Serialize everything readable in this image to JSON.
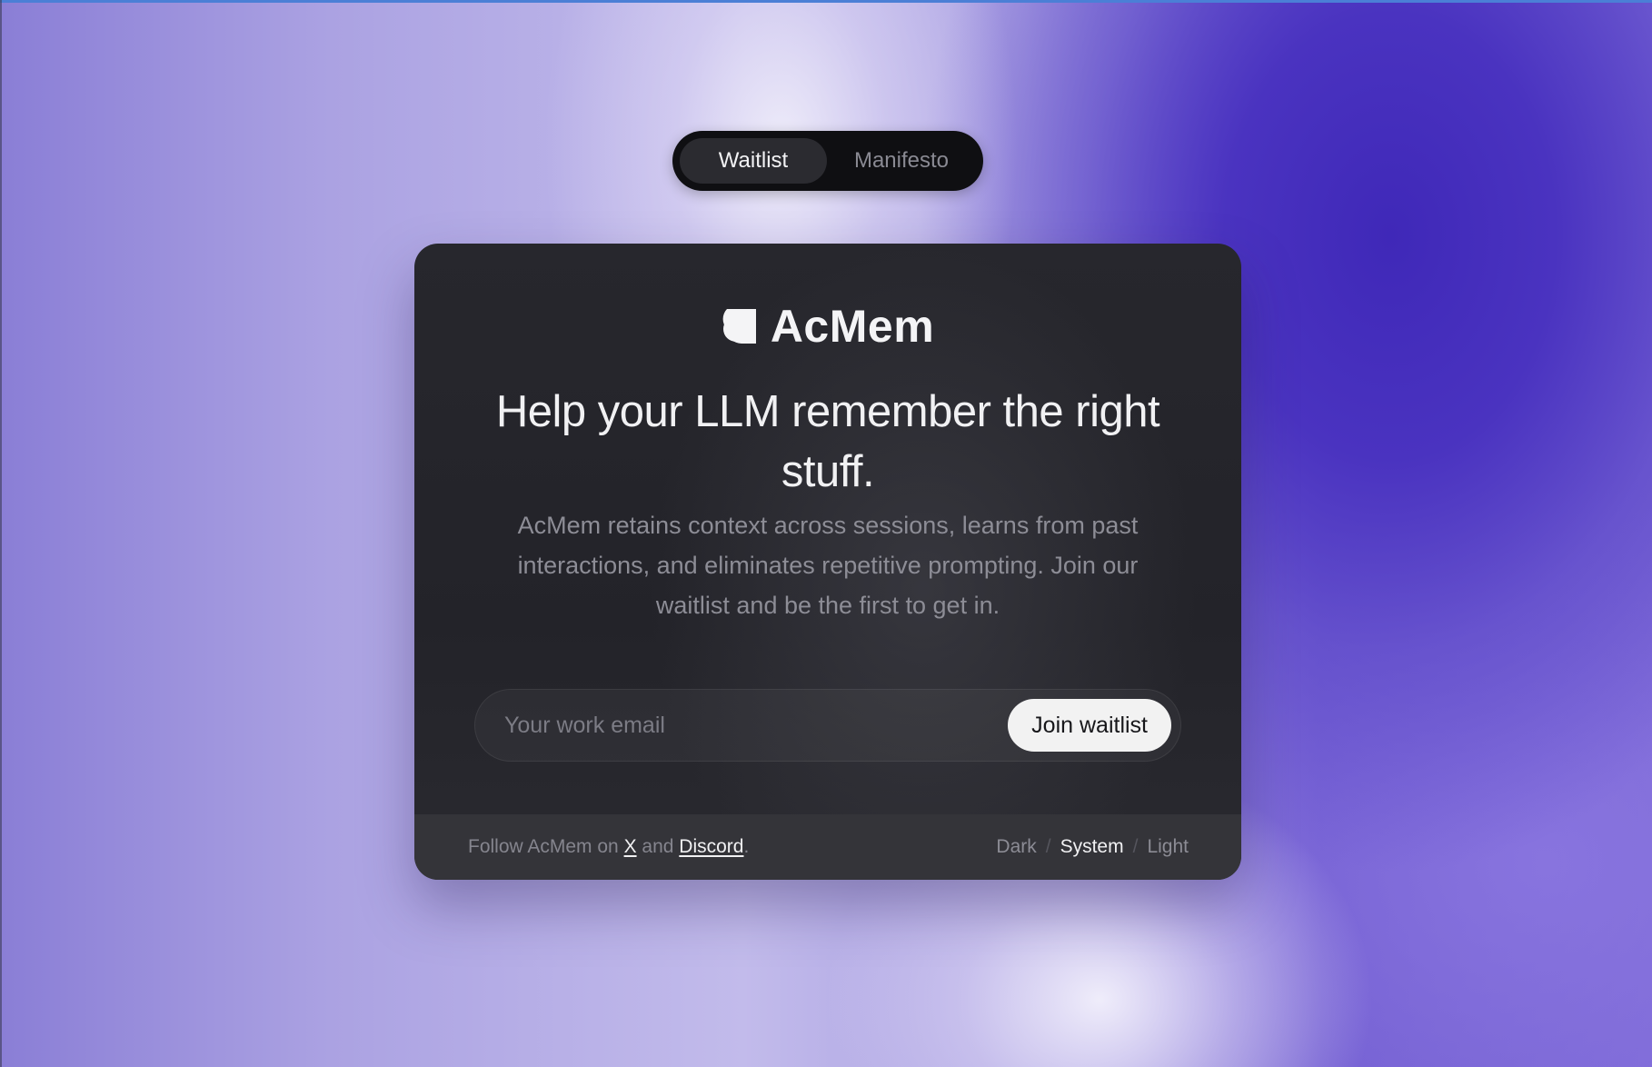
{
  "nav": {
    "tabs": [
      {
        "label": "Waitlist",
        "active": true
      },
      {
        "label": "Manifesto",
        "active": false
      }
    ]
  },
  "brand": {
    "name": "AcMem",
    "logo_icon": "acmem-logo-icon"
  },
  "hero": {
    "headline": "Help your LLM remember the right stuff.",
    "subtext": "AcMem retains context across sessions, learns from past interactions, and eliminates repetitive prompting. Join our waitlist and be the first to get in."
  },
  "form": {
    "email_placeholder": "Your work email",
    "email_value": "",
    "submit_label": "Join waitlist"
  },
  "footer": {
    "follow_prefix": "Follow AcMem on ",
    "x_label": "X",
    "and_text": " and ",
    "discord_label": "Discord",
    "period": ".",
    "theme_options": {
      "dark": "Dark",
      "system": "System",
      "light": "Light",
      "separator": "/"
    },
    "active_theme": "System"
  },
  "colors": {
    "card_bg": "#27272d",
    "footer_bg": "#343439",
    "accent_bg_purple": "#3f28b8",
    "button_bg": "#f2f2f2"
  }
}
